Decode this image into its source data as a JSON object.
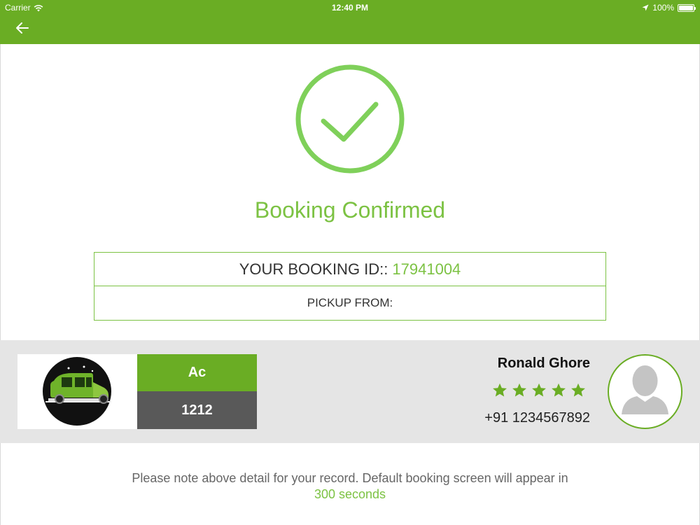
{
  "status_bar": {
    "carrier": "Carrier",
    "time": "12:40 PM",
    "battery": "100%",
    "battery_level": 1.0
  },
  "header": {
    "back_icon": "arrow-left-icon"
  },
  "confirmation": {
    "icon": "check-circle-icon",
    "title": "Booking Confirmed"
  },
  "booking": {
    "id_label": "YOUR BOOKING ID::",
    "id_value": "17941004",
    "pickup_label": "PICKUP FROM:"
  },
  "vehicle": {
    "image": "auto-rickshaw-icon",
    "type": "Ac",
    "number": "1212"
  },
  "driver": {
    "name": "Ronald Ghore",
    "rating": 5,
    "rating_max": 5,
    "phone": "+91 1234567892",
    "avatar": "user-avatar-icon"
  },
  "footer": {
    "note": "Please note above detail for your record. Default booking screen will appear in",
    "seconds": "300 seconds"
  },
  "colors": {
    "brand_green": "#6aad24",
    "accent_green": "#7cc243",
    "band_grey": "#e5e5e5",
    "dark_grey": "#595959"
  }
}
